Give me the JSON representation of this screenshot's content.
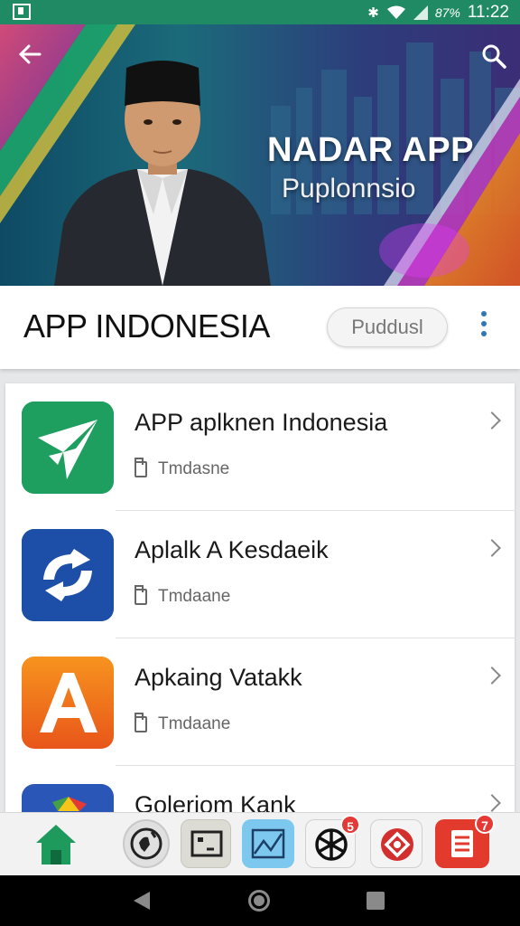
{
  "status_bar": {
    "battery": "87%",
    "time": "11:22",
    "icons": [
      "screenshot-icon",
      "bluetooth-icon",
      "wifi-icon",
      "signal-icon"
    ]
  },
  "banner": {
    "title": "NADAR APP",
    "subtitle": "Puplonnsio",
    "back_icon": "back-arrow-icon",
    "search_icon": "search-icon"
  },
  "header": {
    "title": "APP INDONESIA",
    "chip": "Puddusl",
    "menu_icon": "more-vertical-icon"
  },
  "apps": [
    {
      "name": "APP aplknen Indonesia",
      "sub": "Tmdasne",
      "icon": "green-arrow-app-icon",
      "color": "#1e9a5c"
    },
    {
      "name": "Aplalk A Kesdaeik",
      "sub": "Tmdaane",
      "icon": "blue-refresh-app-icon",
      "color": "#1f4fa3"
    },
    {
      "name": "Apkaing Vatakk",
      "sub": "Tmdaane",
      "icon": "orange-a-app-icon",
      "color": "#f07418"
    },
    {
      "name": "Goleriom Kank",
      "sub": "",
      "icon": "multicolor-app-icon",
      "color": "#2a56b8"
    }
  ],
  "bottom_bar": {
    "items": [
      {
        "icon": "home-icon"
      },
      {
        "icon": "globe-icon"
      },
      {
        "icon": "photo-frame-icon"
      },
      {
        "icon": "chart-icon"
      },
      {
        "icon": "wheel-icon",
        "badge": "5"
      },
      {
        "icon": "red-badge-icon"
      },
      {
        "icon": "list-document-icon",
        "badge": "7"
      }
    ]
  },
  "nav_bar": {
    "icons": [
      "nav-back-icon",
      "nav-home-icon",
      "nav-recents-icon"
    ]
  },
  "colors": {
    "status_bar": "#1f8a63",
    "accent_blue": "#2f78b8",
    "home_green": "#1e9a5c",
    "badge_red": "#e53935"
  }
}
